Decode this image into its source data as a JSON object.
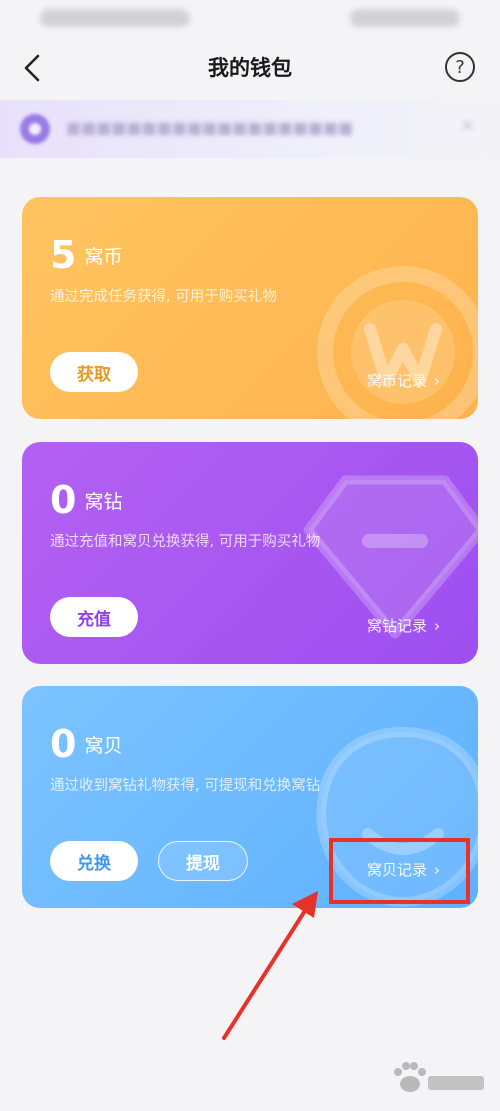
{
  "nav": {
    "title": "我的钱包",
    "help_label": "?"
  },
  "cards": [
    {
      "key": "coin",
      "amount": "5",
      "unit": "窝币",
      "description": "通过完成任务获得, 可用于购买礼物",
      "primary_button": "获取",
      "record_link": "窝币记录"
    },
    {
      "key": "diamond",
      "amount": "0",
      "unit": "窝钻",
      "description": "通过充值和窝贝兑换获得, 可用于购买礼物",
      "primary_button": "充值",
      "record_link": "窝钻记录"
    },
    {
      "key": "shell",
      "amount": "0",
      "unit": "窝贝",
      "description": "通过收到窝钻礼物获得, 可提现和兑换窝钻",
      "primary_button": "兑换",
      "secondary_button": "提现",
      "record_link": "窝贝记录"
    }
  ],
  "colors": {
    "coin_card": "#feb24c",
    "diamond_card": "#9d4fef",
    "shell_card": "#5eb1ff",
    "annotation": "#e5322b",
    "page_bg": "#f4f4f6"
  },
  "icons": {
    "back": "chevron-left-icon",
    "help": "question-circle-icon",
    "chevron": "chevron-right-icon",
    "coin_watermark": "coin-w-icon",
    "diamond_watermark": "diamond-icon",
    "shell_watermark": "shell-icon"
  }
}
